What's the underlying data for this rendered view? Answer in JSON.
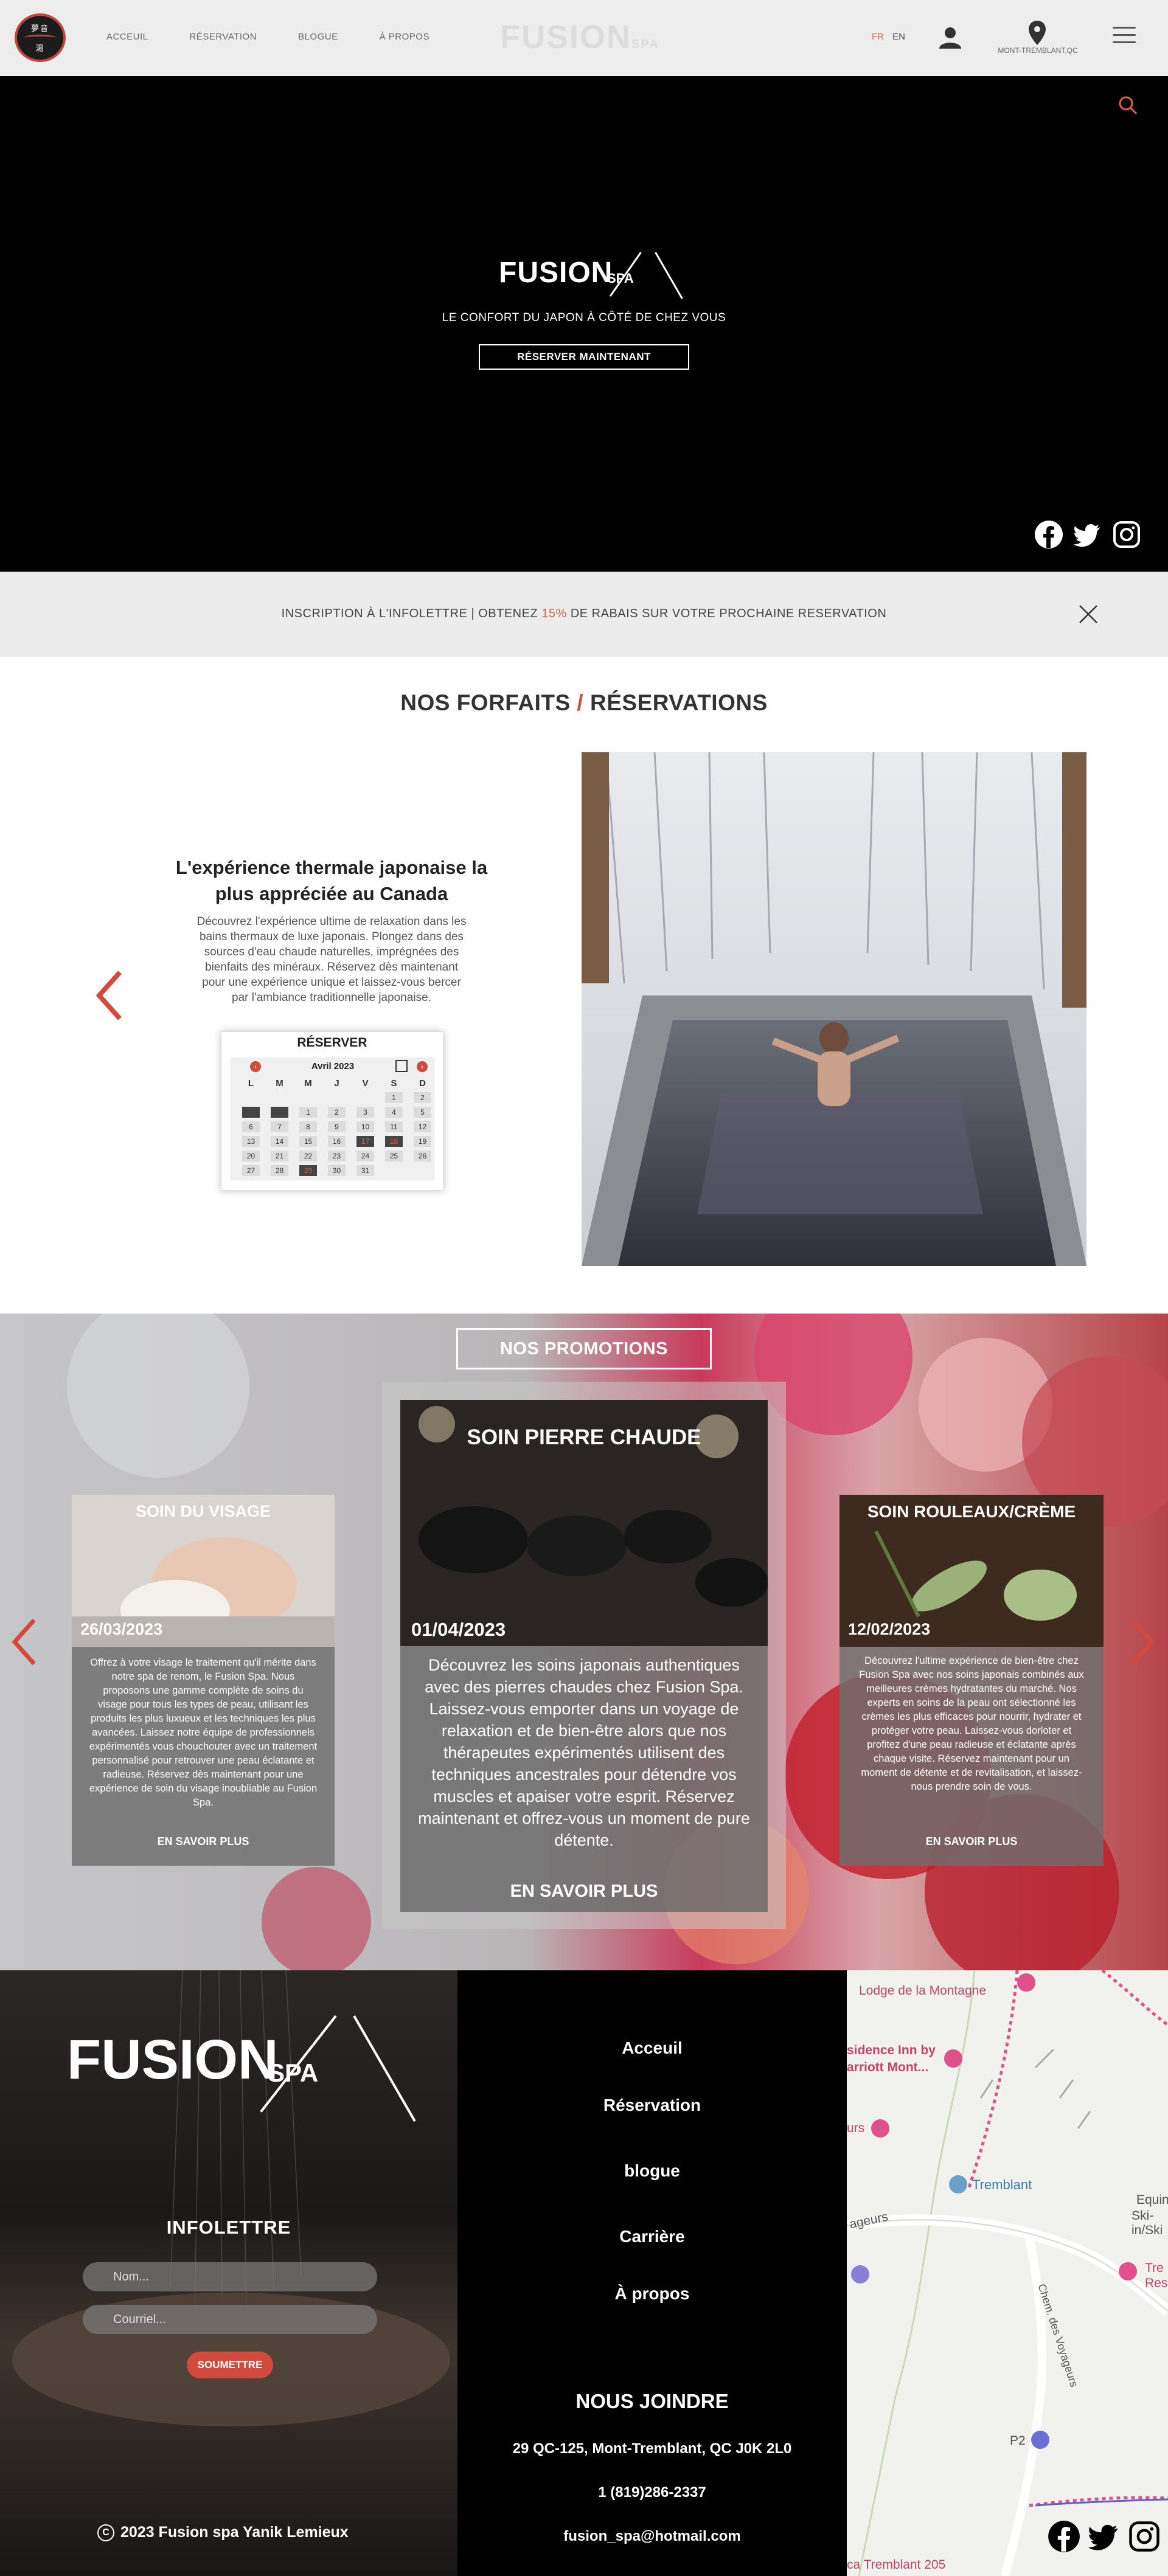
{
  "header": {
    "logo_kanji_top": "夢音",
    "logo_kanji_bottom": "湯",
    "nav": [
      "ACCEUIL",
      "RÉSERVATION",
      "BLOGUE",
      "À PROPOS"
    ],
    "center_logo": "FUSION",
    "center_logo_suffix": "SPA",
    "lang_fr": "FR",
    "lang_en": "EN",
    "location_label": "MONT-TREMBLANT,QC"
  },
  "hero": {
    "logo_word": "FUSION",
    "logo_spa": "SPA",
    "tagline": "LE CONFORT DU JAPON À CÔTÉ DE CHEZ VOUS",
    "cta": "RÉSERVER MAINTENANT"
  },
  "newsletter_bar": {
    "text_before": "INSCRIPTION À L'INFOLETTRE | OBTENEZ ",
    "percent": "15%",
    "text_after": " DE RABAIS SUR VOTRE PROCHAINE RESERVATION"
  },
  "forfaits": {
    "title_left": "NOS FORFAITS ",
    "title_slash": "/",
    "title_right": " RÉSERVATIONS",
    "exp_title": "L'expérience thermale japonaise la plus appréciée au Canada",
    "exp_desc": "Découvrez l'expérience ultime de relaxation dans les bains thermaux de luxe japonais. Plongez dans des sources d'eau chaude naturelles, imprégnées des bienfaits des minéraux. Réservez dès maintenant pour une expérience unique et laissez-vous bercer par l'ambiance traditionnelle japonaise.",
    "reserve_label": "RÉSERVER",
    "calendar": {
      "month": "Avril 2023",
      "days_of_week": [
        "L",
        "M",
        "M",
        "J",
        "V",
        "S",
        "D"
      ],
      "rows": [
        [
          "",
          "",
          "",
          "",
          "",
          "1",
          "2"
        ],
        [
          "",
          "",
          "1",
          "2",
          "3",
          "4",
          "5"
        ],
        [
          "6",
          "7",
          "8",
          "9",
          "10",
          "11",
          "12"
        ],
        [
          "13",
          "14",
          "15",
          "16",
          "17",
          "18",
          "19"
        ],
        [
          "20",
          "21",
          "22",
          "23",
          "24",
          "25",
          "26"
        ],
        [
          "27",
          "28",
          "29",
          "30",
          "31",
          "",
          ""
        ]
      ]
    }
  },
  "promotions": {
    "badge": "NOS PROMOTIONS",
    "cards": [
      {
        "title": "SOIN  DU VISAGE",
        "date": "26/03/2023",
        "text": "Offrez à votre visage le traitement qu'il mérite dans notre spa de renom, le Fusion Spa. Nous proposons une gamme complète de soins du visage pour tous les types de peau, utilisant les produits les plus luxueux et les techniques les plus avancées. Laissez notre équipe de professionnels expérimentés vous chouchouter avec un traitement personnalisé pour retrouver une peau éclatante et radieuse. Réservez dès maintenant pour une expérience de soin du visage inoubliable au Fusion Spa.",
        "more": "EN SAVOIR PLUS"
      },
      {
        "title": "SOIN PIERRE CHAUDE",
        "date": "01/04/2023",
        "text": "Découvrez les soins japonais authentiques avec des pierres chaudes chez Fusion Spa. Laissez-vous emporter dans un voyage de relaxation et de bien-être alors que nos thérapeutes expérimentés utilisent des techniques ancestrales pour détendre vos muscles et apaiser votre esprit. Réservez maintenant et offrez-vous un moment de pure détente.",
        "more": "EN SAVOIR PLUS"
      },
      {
        "title": "SOIN ROULEAUX/CRÈME",
        "date": "12/02/2023",
        "text": "Découvrez l'ultime expérience de bien-être chez Fusion Spa avec nos soins japonais combinés aux meilleures crèmes hydratantes du marché. Nos experts en soins de la peau ont sélectionné les crèmes les plus efficaces pour nourrir, hydrater et protéger votre peau. Laissez-vous dorloter et profitez d'une peau radieuse et éclatante après chaque visite. Réservez maintenant pour un moment de détente et de revitalisation, et laissez-nous prendre soin de vous.",
        "more": "EN SAVOIR PLUS"
      }
    ]
  },
  "footer": {
    "logo_word": "FUSION",
    "logo_spa": "SPA",
    "newsletter_title": "INFOLETTRE",
    "name_placeholder": "Nom...",
    "email_placeholder": "Courriel...",
    "submit": "SOUMETTRE",
    "copyright_symbol": "C",
    "copyright": "2023 Fusion spa Yanik Lemieux",
    "links": [
      "Acceuil",
      "Réservation",
      "blogue",
      "Carrière",
      "À propos"
    ],
    "join_title": "NOUS JOINDRE",
    "address": "29 QC-125, Mont-Tremblant, QC J0K 2L0",
    "phone": "1 (819)286-2337",
    "email": "fusion_spa@hotmail.com"
  },
  "map": {
    "labels": [
      "Lodge de la Montagne",
      "sidence Inn by",
      "arriott Mont...",
      "urs",
      "Tremblant",
      "Equin",
      "Ski-in/Ski",
      "Tre",
      "Res",
      "ageurs",
      "Chem. des Voyageurs",
      "P2",
      "ca Tremblant 205"
    ]
  },
  "colors": {
    "accent": "#d2493d",
    "orange": "#e06048",
    "header_bg": "#ededed",
    "hero_bg": "#000000"
  }
}
